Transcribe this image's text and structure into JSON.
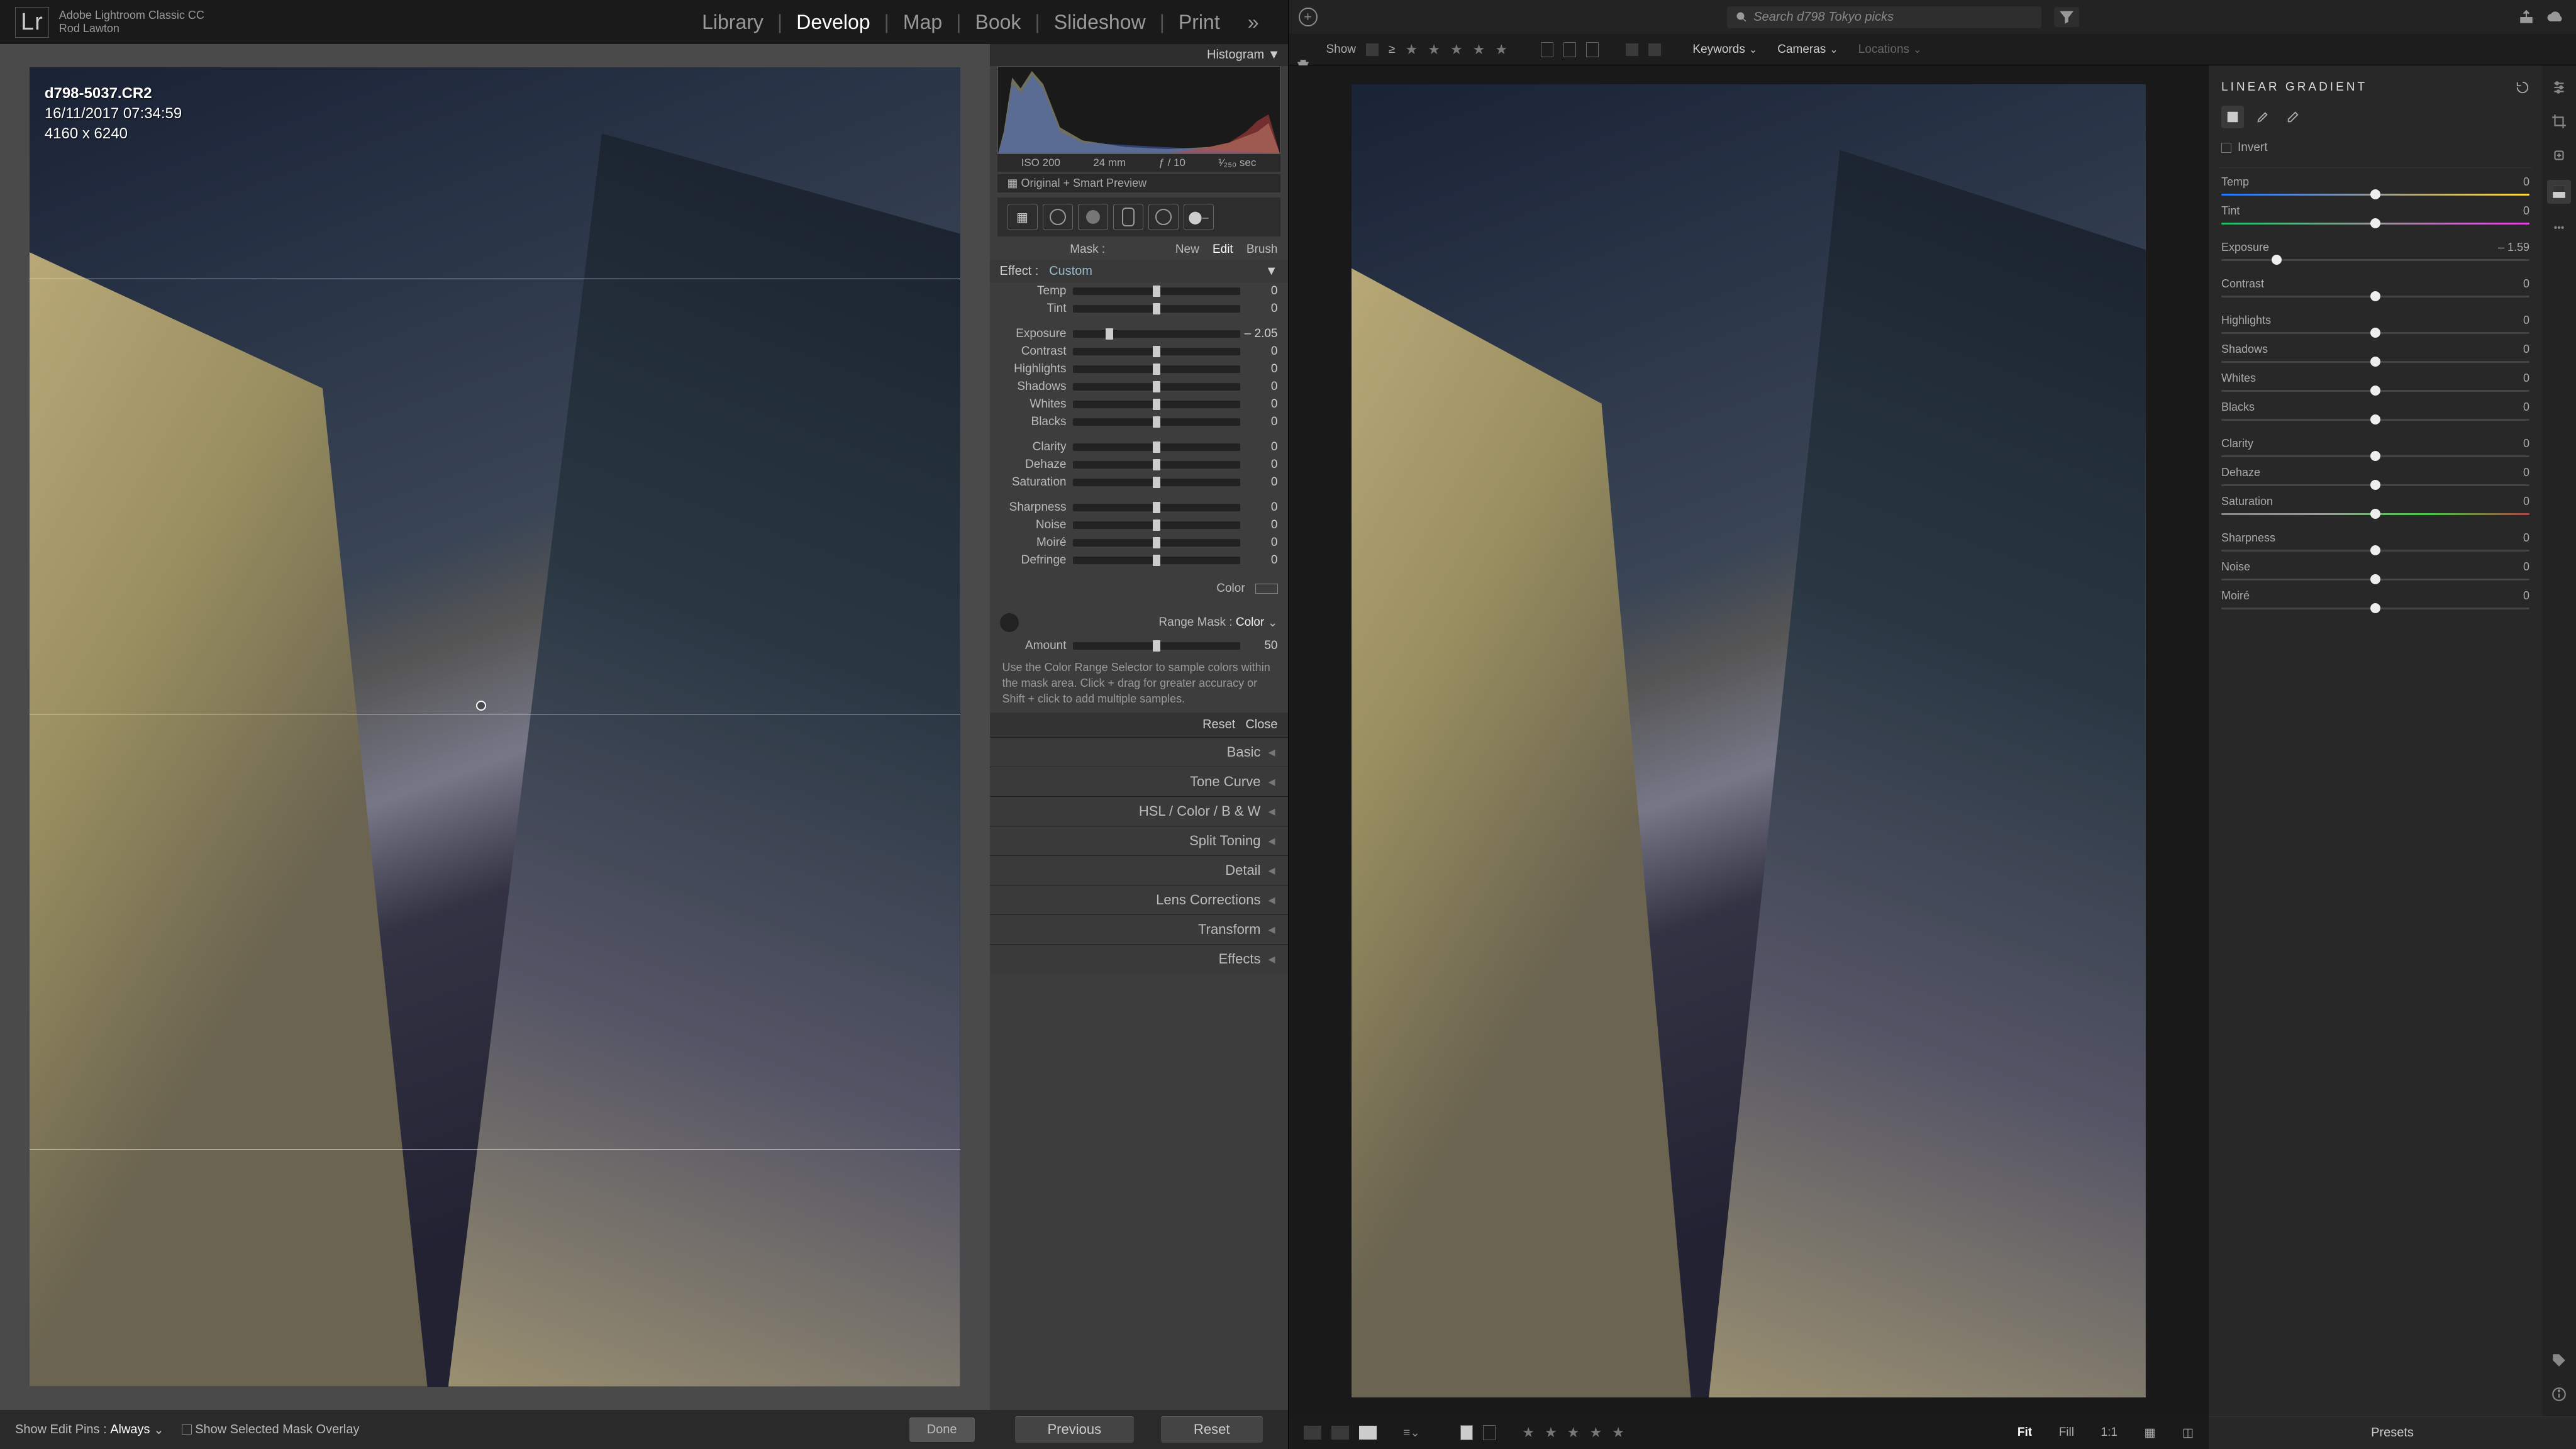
{
  "left": {
    "brand": "Lr",
    "product": "Adobe Lightroom Classic CC",
    "user": "Rod Lawton",
    "modules": [
      "Library",
      "Develop",
      "Map",
      "Book",
      "Slideshow",
      "Print",
      "»"
    ],
    "activeModule": "Develop",
    "image": {
      "filename": "d798-5037.CR2",
      "datetime": "16/11/2017 07:34:59",
      "dimensions": "4160 x 6240"
    },
    "histogram": {
      "title": "Histogram",
      "iso": "ISO 200",
      "focal": "24 mm",
      "aperture": "ƒ / 10",
      "shutter": "¹⁄₂₅₀ sec",
      "previewStatus": "Original + Smart Preview"
    },
    "maskRow": {
      "label": "Mask :",
      "new": "New",
      "edit": "Edit",
      "brush": "Brush"
    },
    "effect": {
      "label": "Effect :",
      "value": "Custom"
    },
    "sliders": {
      "Temp": {
        "v": 0,
        "pos": 50
      },
      "Tint": {
        "v": 0,
        "pos": 50
      },
      "Exposure": {
        "v": "– 2.05",
        "pos": 22
      },
      "Contrast": {
        "v": 0,
        "pos": 50
      },
      "Highlights": {
        "v": 0,
        "pos": 50
      },
      "Shadows": {
        "v": 0,
        "pos": 50
      },
      "Whites": {
        "v": 0,
        "pos": 50
      },
      "Blacks": {
        "v": 0,
        "pos": 50
      },
      "Clarity": {
        "v": 0,
        "pos": 50
      },
      "Dehaze": {
        "v": 0,
        "pos": 50
      },
      "Saturation": {
        "v": 0,
        "pos": 50
      },
      "Sharpness": {
        "v": 0,
        "pos": 50
      },
      "Noise": {
        "v": 0,
        "pos": 50
      },
      "Moiré": {
        "v": 0,
        "pos": 50
      },
      "Defringe": {
        "v": 0,
        "pos": 50
      }
    },
    "colorLabel": "Color",
    "rangeMask": {
      "label": "Range Mask :",
      "mode": "Color",
      "amountLabel": "Amount",
      "amount": 50,
      "help": "Use the Color Range Selector to sample colors within the mask area. Click + drag for greater accuracy or Shift + click to add multiple samples."
    },
    "resetBtn": "Reset",
    "closeBtn": "Close",
    "panels": [
      "Basic",
      "Tone Curve",
      "HSL / Color / B & W",
      "Split Toning",
      "Detail",
      "Lens Corrections",
      "Transform",
      "Effects"
    ],
    "footer": {
      "pins": "Show Edit Pins :",
      "pinsMode": "Always",
      "overlay": "Show Selected Mask Overlay",
      "done": "Done"
    },
    "nav": {
      "prev": "Previous",
      "reset": "Reset"
    }
  },
  "right": {
    "searchPlaceholder": "Search d798 Tokyo picks",
    "show": "Show",
    "dropdowns": [
      "Keywords",
      "Cameras",
      "Locations"
    ],
    "section": "LINEAR GRADIENT",
    "invert": "Invert",
    "sliders": [
      {
        "name": "Temp",
        "v": 0,
        "pos": 50,
        "cls": "temp"
      },
      {
        "name": "Tint",
        "v": 0,
        "pos": 50,
        "cls": "tint"
      },
      {
        "name": "Exposure",
        "v": "– 1.59",
        "pos": 18,
        "cls": ""
      },
      {
        "name": "Contrast",
        "v": 0,
        "pos": 50,
        "cls": ""
      },
      {
        "name": "Highlights",
        "v": 0,
        "pos": 50,
        "cls": ""
      },
      {
        "name": "Shadows",
        "v": 0,
        "pos": 50,
        "cls": ""
      },
      {
        "name": "Whites",
        "v": 0,
        "pos": 50,
        "cls": ""
      },
      {
        "name": "Blacks",
        "v": 0,
        "pos": 50,
        "cls": ""
      },
      {
        "name": "Clarity",
        "v": 0,
        "pos": 50,
        "cls": ""
      },
      {
        "name": "Dehaze",
        "v": 0,
        "pos": 50,
        "cls": ""
      },
      {
        "name": "Saturation",
        "v": 0,
        "pos": 50,
        "cls": "sat"
      },
      {
        "name": "Sharpness",
        "v": 0,
        "pos": 50,
        "cls": ""
      },
      {
        "name": "Noise",
        "v": 0,
        "pos": 50,
        "cls": ""
      },
      {
        "name": "Moiré",
        "v": 0,
        "pos": 50,
        "cls": ""
      }
    ],
    "footer": {
      "fit": "Fit",
      "fill": "Fill",
      "ratio": "1:1"
    },
    "presets": "Presets"
  }
}
